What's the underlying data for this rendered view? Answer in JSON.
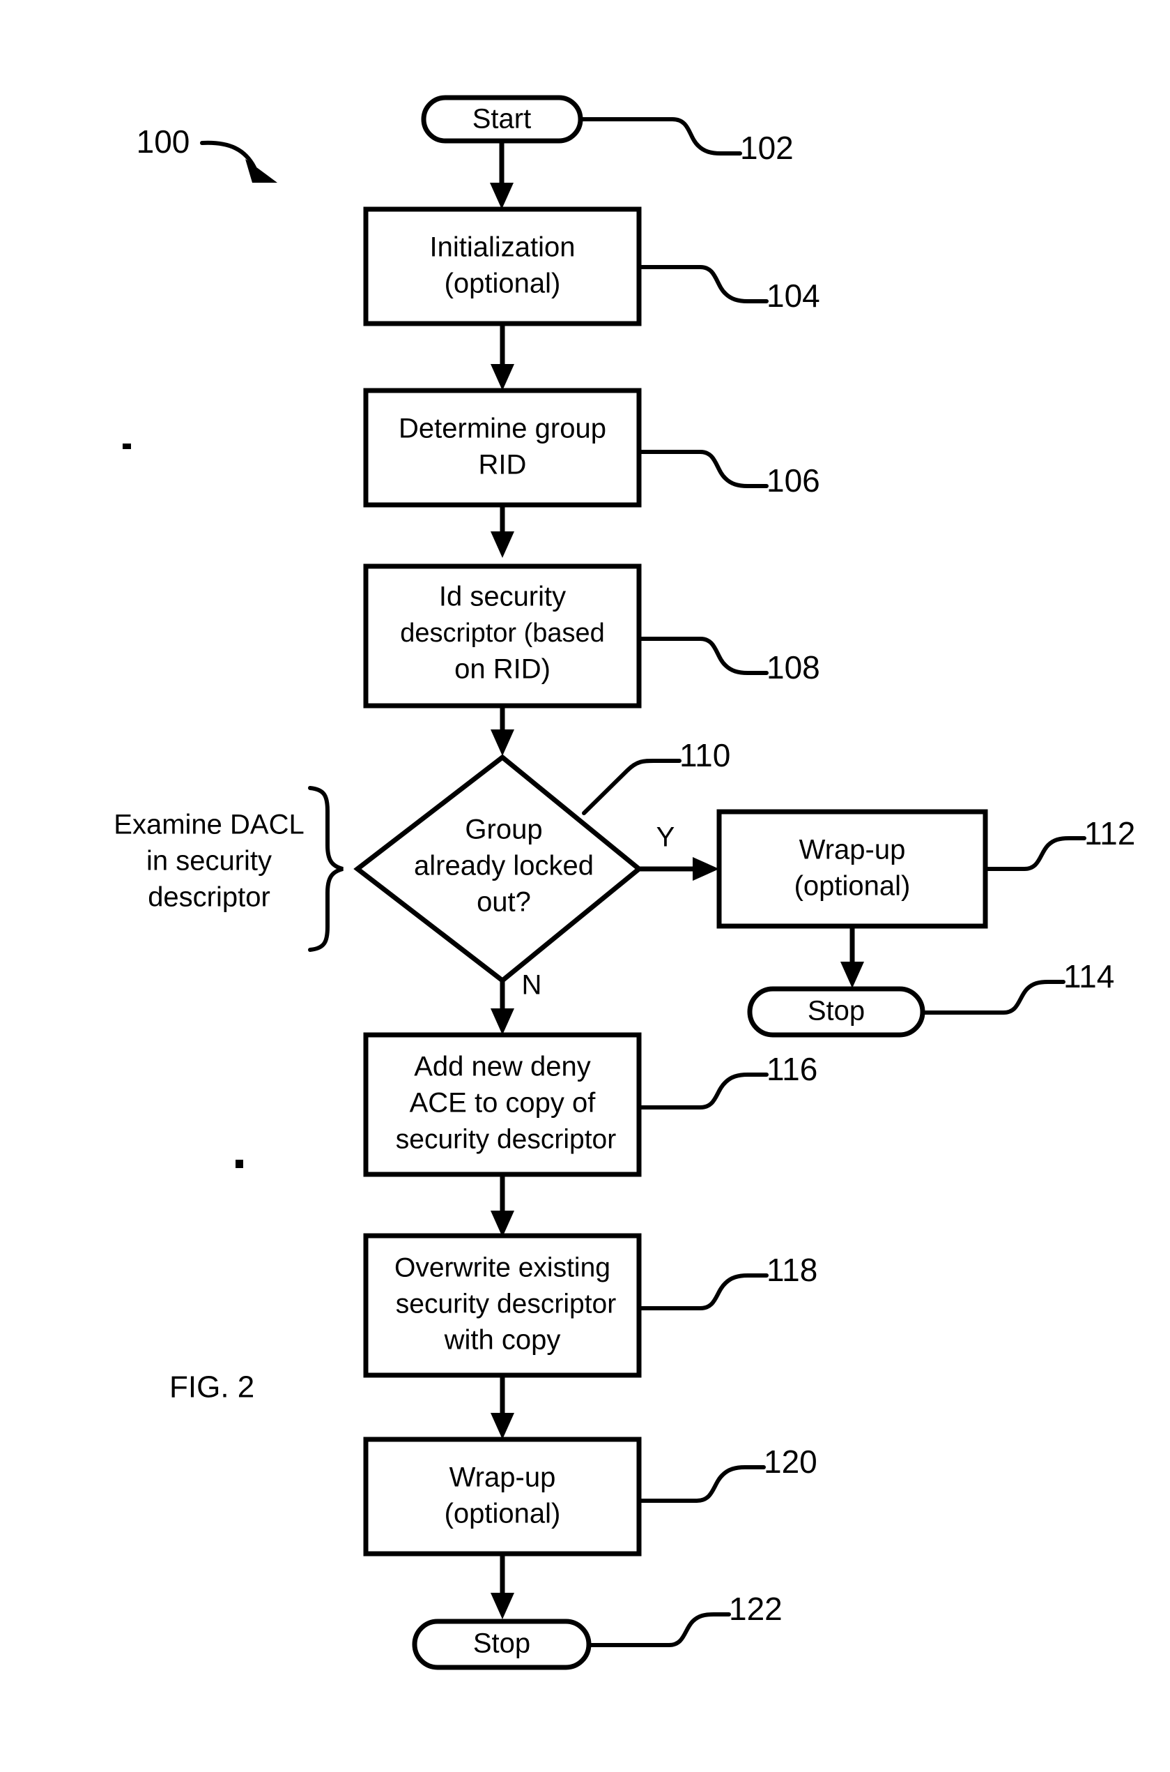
{
  "figure": {
    "label": "FIG. 2",
    "process_ref": "100"
  },
  "nodes": [
    {
      "id": "start",
      "kind": "terminator",
      "ref": "102",
      "lines": [
        "Start"
      ]
    },
    {
      "id": "init",
      "kind": "process",
      "ref": "104",
      "lines": [
        "Initialization",
        "(optional)"
      ]
    },
    {
      "id": "determine",
      "kind": "process",
      "ref": "106",
      "lines": [
        "Determine group",
        "RID"
      ]
    },
    {
      "id": "idsec",
      "kind": "process",
      "ref": "108",
      "lines": [
        "Id security",
        "descriptor (based",
        "on RID)"
      ]
    },
    {
      "id": "decision",
      "kind": "decision",
      "ref": "110",
      "lines": [
        "Group",
        "already locked",
        "out?"
      ]
    },
    {
      "id": "wrapup_y",
      "kind": "process",
      "ref": "112",
      "lines": [
        "Wrap-up",
        "(optional)"
      ]
    },
    {
      "id": "stop_y",
      "kind": "terminator",
      "ref": "114",
      "lines": [
        "Stop"
      ]
    },
    {
      "id": "addace",
      "kind": "process",
      "ref": "116",
      "lines": [
        "Add new deny",
        "ACE to copy of",
        "security descriptor"
      ]
    },
    {
      "id": "overwrite",
      "kind": "process",
      "ref": "118",
      "lines": [
        "Overwrite existing",
        "security descriptor",
        "with copy"
      ]
    },
    {
      "id": "wrapup_n",
      "kind": "process",
      "ref": "120",
      "lines": [
        "Wrap-up",
        "(optional)"
      ]
    },
    {
      "id": "stop_n",
      "kind": "terminator",
      "ref": "122",
      "lines": [
        "Stop"
      ]
    }
  ],
  "branch_labels": {
    "yes": "Y",
    "no": "N"
  },
  "annotation": {
    "dacl_note": [
      "Examine DACL",
      "in security",
      "descriptor"
    ]
  },
  "colors": {
    "ink": "#000000",
    "paper": "#ffffff"
  }
}
